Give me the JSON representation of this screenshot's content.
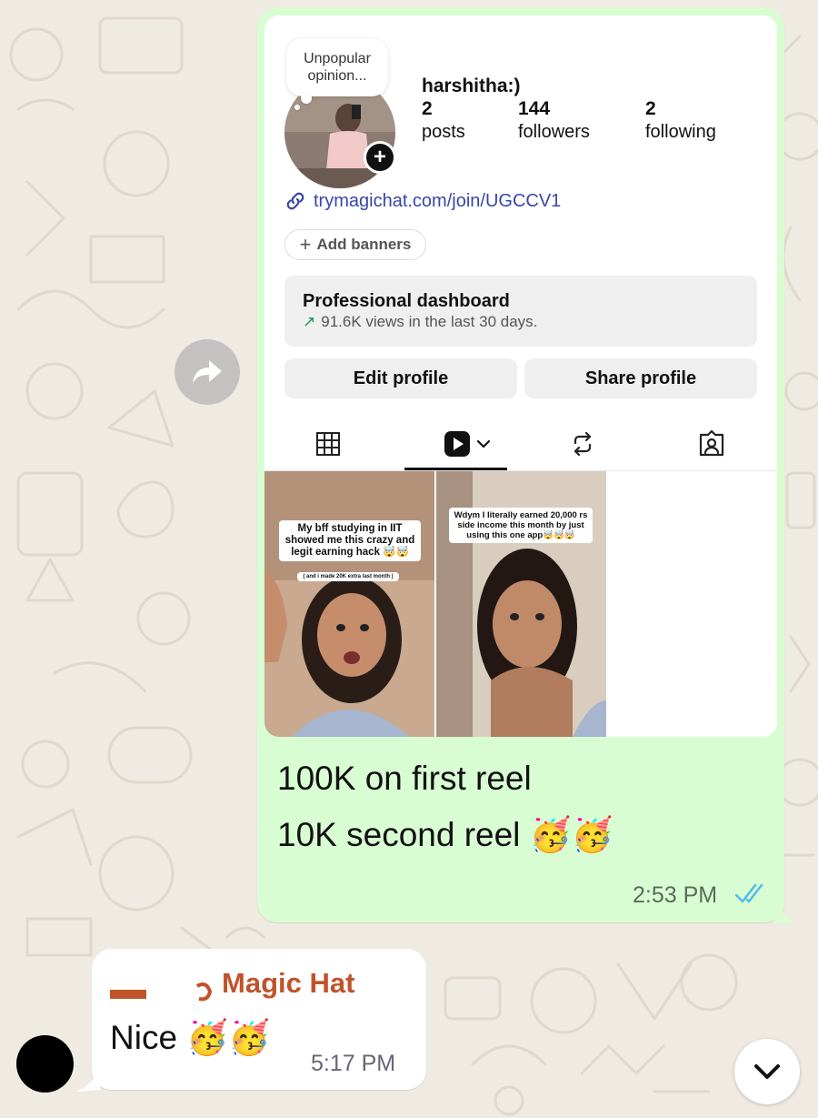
{
  "profile": {
    "note": [
      "Unpopular",
      "opinion..."
    ],
    "username": "harshitha:)",
    "stats": [
      {
        "count": "2",
        "label": "posts"
      },
      {
        "count": "144",
        "label": "followers"
      },
      {
        "count": "2",
        "label": "following"
      }
    ],
    "link": "trymagichat.com/join/UGCCV1",
    "add_banners": "Add banners",
    "dashboard_title": "Professional dashboard",
    "dashboard_sub": "91.6K views in the last 30 days.",
    "edit_profile": "Edit profile",
    "share_profile": "Share profile",
    "tabs": [
      "grid-icon",
      "reels-icon",
      "reposts-icon",
      "tagged-icon"
    ],
    "reels": [
      {
        "caption": [
          "My bff studying in IIT",
          "showed me this crazy and",
          "legit earning hack 🤯🤯"
        ],
        "sub": "( and i made 20K extra last month )"
      },
      {
        "caption": [
          "Wdym I literally earned 20,000 rs",
          "side income this month by just",
          "using this one app🤯🤯🤯"
        ]
      }
    ]
  },
  "sent_message": {
    "lines": [
      "100K on first reel",
      "10K second reel 🥳🥳"
    ],
    "time": "2:53 PM",
    "status": "read"
  },
  "received_message": {
    "sender": "Magic Hat",
    "text": "Nice 🥳🥳",
    "time": "5:17 PM"
  },
  "colors": {
    "sent_bg": "#d9fdd3",
    "received_bg": "#ffffff",
    "wallpaper": "#efeae2",
    "sender_name": "#c0532a",
    "read_ticks": "#53bdeb",
    "link": "#3846a8"
  }
}
